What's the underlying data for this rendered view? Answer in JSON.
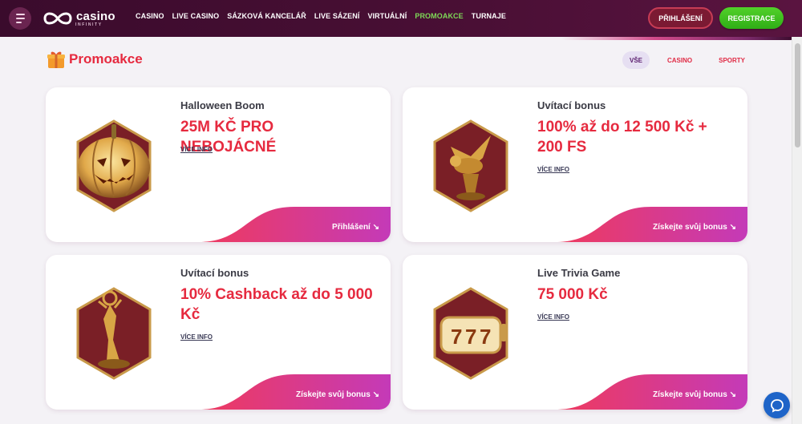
{
  "header": {
    "logo_text": "casino",
    "logo_sub": "INFINITY",
    "nav": [
      {
        "label": "CASINO",
        "active": false
      },
      {
        "label": "LIVE CASINO",
        "active": false
      },
      {
        "label": "SÁZKOVÁ KANCELÁŘ",
        "active": false
      },
      {
        "label": "LIVE SÁZENÍ",
        "active": false
      },
      {
        "label": "VIRTUÁLNÍ",
        "active": false
      },
      {
        "label": "PROMOAKCE",
        "active": true
      },
      {
        "label": "TURNAJE",
        "active": false
      }
    ],
    "login_label": "PŘIHLÁŠENÍ",
    "register_label": "REGISTRACE"
  },
  "page": {
    "title": "Promoakce",
    "filters": [
      {
        "label": "VŠE",
        "active": true
      },
      {
        "label": "CASINO",
        "active": false
      },
      {
        "label": "SPORTY",
        "active": false
      }
    ]
  },
  "cards": [
    {
      "label": "Halloween Boom",
      "title": "25M KČ PRO NEBOJÁCNÉ",
      "more": "VÍCE INFO",
      "cta": "Přihlášení ↘",
      "art": "pumpkin-icon"
    },
    {
      "label": "Uvítací bonus",
      "title": "100% až do 12 500 Kč + 200 FS",
      "more": "VÍCE INFO",
      "cta": "Získejte svůj bonus ↘",
      "art": "winged-lion-icon"
    },
    {
      "label": "Uvítací bonus",
      "title": "10% Cashback až do 5 000 Kč",
      "more": "VÍCE INFO",
      "cta": "Získejte svůj bonus ↘",
      "art": "trophy-icon"
    },
    {
      "label": "Live Trivia Game",
      "title": "75 000 Kč",
      "more": "VÍCE INFO",
      "cta": "Získejte svůj bonus ↘",
      "art": "slot-777-icon"
    }
  ],
  "colors": {
    "accent": "#e62a3f",
    "header_bg": "#3a0b2c",
    "nav_active": "#7ed957",
    "register": "#3dbb1c",
    "cta_gradient_start": "#ef3a5d",
    "cta_gradient_end": "#c43ab8"
  }
}
